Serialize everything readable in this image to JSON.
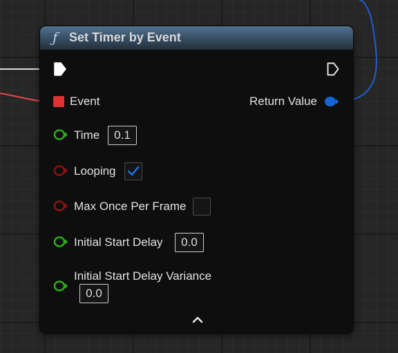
{
  "node": {
    "title": "Set Timer by Event",
    "function_icon": "function-icon",
    "collapse_icon": "chevron-up-icon"
  },
  "pins": {
    "event": {
      "label": "Event",
      "color": "#e03232"
    },
    "return_value": {
      "label": "Return Value",
      "color": "#1565d8"
    },
    "time": {
      "label": "Time",
      "value": "0.1",
      "color": "#2fae1a"
    },
    "looping": {
      "label": "Looping",
      "checked": true,
      "color": "#8c1212"
    },
    "max_once": {
      "label": "Max Once Per Frame",
      "checked": false,
      "color": "#8c1212"
    },
    "initial_delay": {
      "label": "Initial Start Delay",
      "value": "0.0",
      "color": "#2fae1a"
    },
    "delay_variance": {
      "label": "Initial Start Delay Variance",
      "value": "0.0",
      "color": "#2fae1a"
    }
  },
  "colors": {
    "header": "#3a526a",
    "node_body": "#0e0e0e",
    "checkbox_tick": "#1e6fe0"
  }
}
